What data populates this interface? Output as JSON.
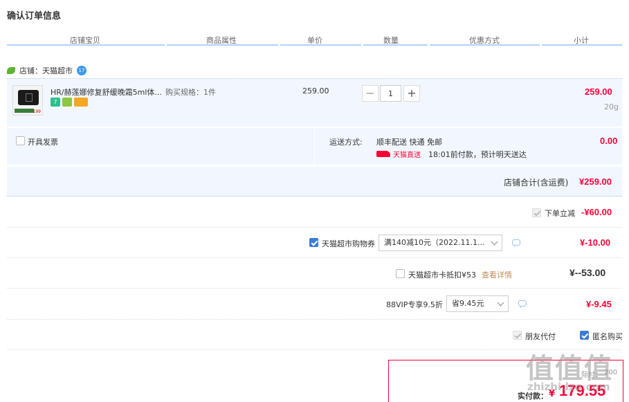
{
  "page": {
    "title": "确认订单信息"
  },
  "columns": [
    "店铺宝贝",
    "商品属性",
    "单价",
    "数量",
    "优惠方式",
    "小计"
  ],
  "shop": {
    "label": "店铺：天猫超市",
    "badge": "17"
  },
  "item": {
    "name": "HR/赫莲娜修复舒缓晚霜5ml体...",
    "spec": "购买规格：1件",
    "unit_price": "259.00",
    "quantity": "1",
    "subtotal": "259.00",
    "weight": "20g",
    "thumb_num": "199",
    "badges": [
      {
        "icon": "seven-day-return-icon",
        "text": "7",
        "color": "#2dbf8f"
      },
      {
        "icon": "guarantee-icon",
        "text": "",
        "color": "#8dc63f"
      },
      {
        "icon": "card-icon",
        "text": "",
        "color": "#f5a623"
      }
    ],
    "minus_label": "−",
    "plus_label": "+"
  },
  "service": {
    "invoice_label": "开具发票",
    "shipping_label": "运送方式:",
    "shipping_value": "顺丰配送 快通 免邮",
    "shipping_tag": "天猫直送",
    "shipping_note": "18:01前付款，预计明天送达",
    "shipping_fee": "0.00"
  },
  "shop_total": {
    "label": "店铺合计(含运费)",
    "value": "¥259.00"
  },
  "discounts": {
    "instant": {
      "label": "下单立减",
      "value": "-¥60.00"
    },
    "coupon": {
      "label": "天猫超市购物券",
      "select": "满140减10元（2022.11.1...",
      "value": "¥-10.00"
    },
    "card": {
      "label": "天猫超市卡抵扣¥53",
      "link": "查看详情",
      "value": "¥--53.00"
    },
    "vip": {
      "label": "88VIP专享9.5折",
      "select": "省9.45元",
      "value": "¥-9.45"
    }
  },
  "options": {
    "friend_pay": "朋友代付",
    "anonymous": "匿名购买"
  },
  "final": {
    "partial_label": "际付：",
    "partial_value": "200",
    "pay_label": "实付款：",
    "currency": "¥",
    "amount": "179.55"
  },
  "watermark": {
    "logo": "值值值",
    "site": "zhizhi.lzo.com"
  },
  "colors": {
    "accent_red": "#ff0036",
    "light_blue_bg": "#f2f7ff",
    "blue_line": "#b2d1ff",
    "checkbox_blue": "#3d7dd6"
  }
}
